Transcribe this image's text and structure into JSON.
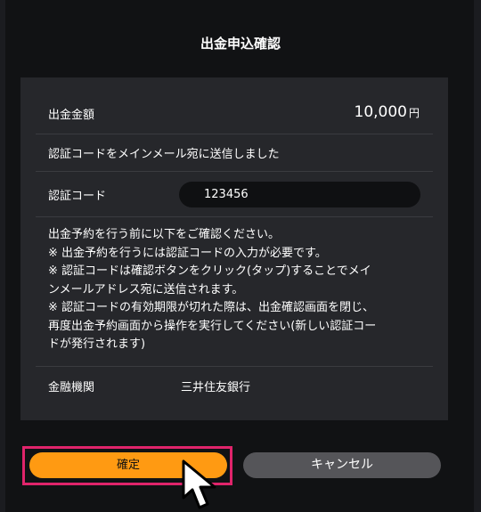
{
  "dialog": {
    "title": "出金申込確認"
  },
  "amount": {
    "label": "出金金額",
    "value": "10,000",
    "unit": "円"
  },
  "message": "認証コードをメインメール宛に送信しました",
  "code": {
    "label": "認証コード",
    "value": "123456"
  },
  "notice": [
    "出金予約を行う前に以下をご確認ください。",
    "※ 出金予約を行うには認証コードの入力が必要です。",
    "※ 認証コードは確認ボタンをクリック(タップ)することでメイ",
    "ンメールアドレス宛に送信されます。",
    "※ 認証コードの有効期限が切れた際は、出金確認画面を閉じ、",
    "再度出金予約画面から操作を実行してください(新しい認証コー",
    "ドが発行されます)"
  ],
  "bank": {
    "label": "金融機関",
    "value": "三井住友銀行"
  },
  "buttons": {
    "confirm": "確定",
    "cancel": "キャンセル"
  },
  "colors": {
    "accent": "#ff9a12",
    "highlight": "#e0246b",
    "panel": "#26272b"
  },
  "icons": {
    "cursor": "arrow-cursor-icon"
  }
}
